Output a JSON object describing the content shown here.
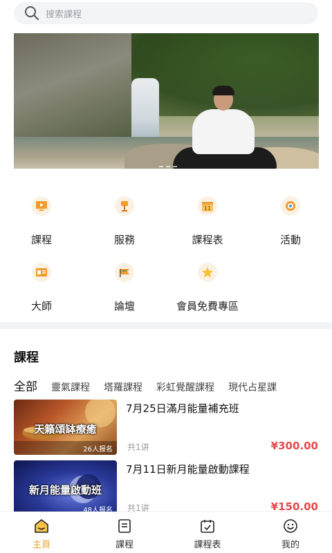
{
  "search": {
    "placeholder": "搜索課程"
  },
  "menu": [
    {
      "label": "課程",
      "icon": "monitor-icon"
    },
    {
      "label": "服務",
      "icon": "lamp-icon"
    },
    {
      "label": "課程表",
      "icon": "calendar-icon"
    },
    {
      "label": "活動",
      "icon": "medal-icon"
    },
    {
      "label": "大師",
      "icon": "id-card-icon"
    },
    {
      "label": "論壇",
      "icon": "flag-icon"
    },
    {
      "label": "會員免費專區",
      "icon": "star-icon"
    }
  ],
  "section": {
    "title": "課程"
  },
  "tabs": [
    "全部",
    "靈氣課程",
    "塔羅課程",
    "彩虹覺醒課程",
    "現代占星課"
  ],
  "courses": [
    {
      "title": "7月25日滿月能量補充班",
      "thumb_title": "天籟頌缽療癒",
      "thumb_count": "26人报名",
      "meta": "共1讲",
      "price": "¥300.00"
    },
    {
      "title": "7月11日新月能量啟動課程",
      "thumb_title": "新月能量啟動班",
      "thumb_count": "48人报名",
      "meta": "共1讲",
      "price": "¥150.00"
    }
  ],
  "nav": [
    {
      "label": "主頁",
      "icon": "home-icon",
      "active": true
    },
    {
      "label": "課程",
      "icon": "document-icon"
    },
    {
      "label": "課程表",
      "icon": "calendar-check-icon"
    },
    {
      "label": "我的",
      "icon": "smile-icon"
    }
  ],
  "colors": {
    "accent": "#e7a22a",
    "price": "#e5484d"
  }
}
